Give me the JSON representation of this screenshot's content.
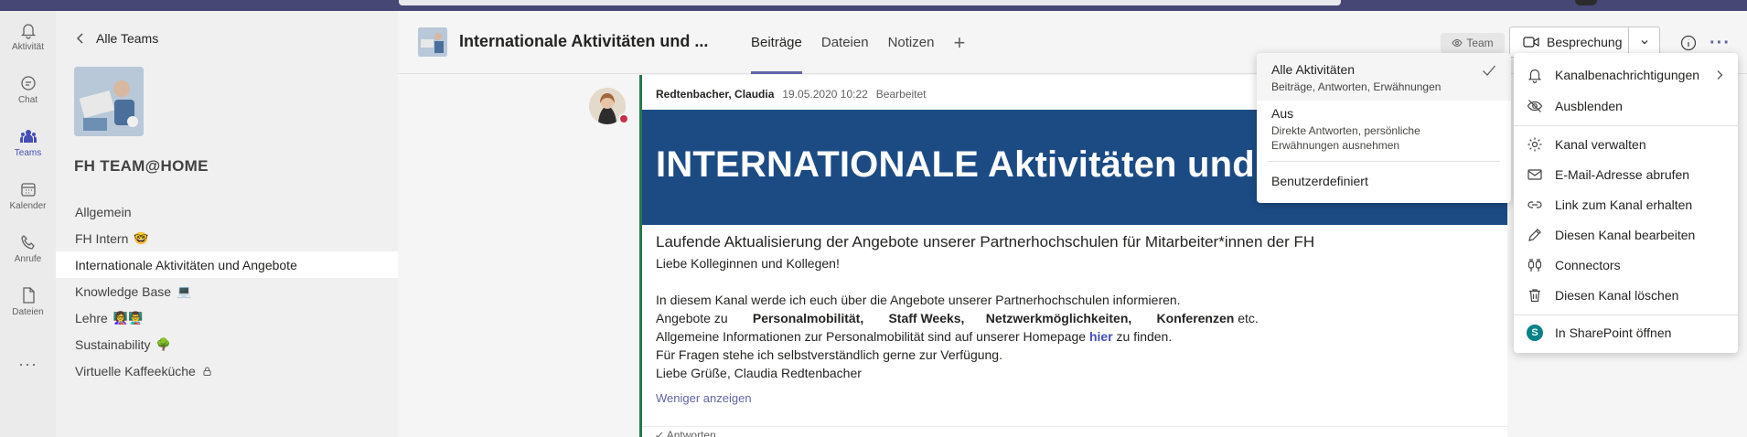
{
  "rail": {
    "items": [
      {
        "label": "Aktivität",
        "icon": "bell-icon"
      },
      {
        "label": "Chat",
        "icon": "chat-icon"
      },
      {
        "label": "Teams",
        "icon": "teams-icon"
      },
      {
        "label": "Kalender",
        "icon": "calendar-icon"
      },
      {
        "label": "Anrufe",
        "icon": "phone-icon"
      },
      {
        "label": "Dateien",
        "icon": "file-icon"
      }
    ],
    "more": "···",
    "active_color": "#464eb8"
  },
  "panel": {
    "back_label": "Alle Teams",
    "team_name": "FH TEAM@HOME",
    "channels": [
      {
        "label": "Allgemein",
        "emoji": ""
      },
      {
        "label": "FH Intern",
        "emoji": "🤓"
      },
      {
        "label": "Internationale Aktivitäten und Angebote",
        "emoji": ""
      },
      {
        "label": "Knowledge Base",
        "emoji": "💻"
      },
      {
        "label": "Lehre",
        "emoji": "👩‍🏫👨‍🏫"
      },
      {
        "label": "Sustainability",
        "emoji": "🌳"
      },
      {
        "label": "Virtuelle Kaffeeküche",
        "emoji": ""
      }
    ]
  },
  "header": {
    "channel_title": "Internationale Aktivitäten und ...",
    "tabs": [
      "Beiträge",
      "Dateien",
      "Notizen"
    ],
    "add_tab": "+",
    "team_badge": "Team",
    "meet_label": "Besprechung",
    "accent": "#6264a7"
  },
  "post": {
    "author": "Redtenbacher, Claudia",
    "timestamp": "19.05.2020 10:22",
    "edited": "Bearbeitet",
    "banner_text": "INTERNATIONALE Aktivitäten und A",
    "banner_color": "#1c4b84",
    "subject": "Laufende Aktualisierung der Angebote unserer Partnerhochschulen für Mitarbeiter*innen der FH",
    "greeting": "Liebe Kolleginnen und Kollegen!",
    "line1": "In diesem Kanal werde ich euch über die Angebote unserer Partnerhochschulen informieren.",
    "line2_prefix": "Angebote zu",
    "line2_b1": "Personalmobilität,",
    "line2_b2": "Staff Weeks,",
    "line2_b3": "Netzwerkmöglichkeiten,",
    "line2_b4": "Konferenzen",
    "line2_suffix": "etc.",
    "line3_prefix": "Allgemeine Informationen zur Personalmobilität sind auf unserer Homepage",
    "line3_link": "hier",
    "line3_suffix": "zu finden.",
    "line4": "Für Fragen stehe ich selbstverständlich gerne zur Verfügung.",
    "line5": "Liebe Grüße, Claudia Redtenbacher",
    "show_less": "Weniger anzeigen",
    "reply": "↙ Antworten"
  },
  "notifications": {
    "items": [
      {
        "title": "Alle Aktivitäten",
        "desc": "Beiträge, Antworten, Erwähnungen"
      },
      {
        "title": "Aus",
        "desc": "Direkte Antworten, persönliche Erwähnungen ausnehmen"
      },
      {
        "title": "Benutzerdefiniert",
        "desc": ""
      }
    ]
  },
  "menu": {
    "items": [
      {
        "label": "Kanalbenachrichtigungen",
        "icon": "bell-icon"
      },
      {
        "label": "Ausblenden",
        "icon": "eye-off-icon"
      },
      {
        "label": "Kanal verwalten",
        "icon": "gear-icon"
      },
      {
        "label": "E-Mail-Adresse abrufen",
        "icon": "mail-icon"
      },
      {
        "label": "Link zum Kanal erhalten",
        "icon": "link-icon"
      },
      {
        "label": "Diesen Kanal bearbeiten",
        "icon": "pencil-icon"
      },
      {
        "label": "Connectors",
        "icon": "connector-icon"
      },
      {
        "label": "Diesen Kanal löschen",
        "icon": "trash-icon"
      },
      {
        "label": "In SharePoint öffnen",
        "icon": "sharepoint-icon"
      }
    ],
    "sharepoint_glyph": "S"
  }
}
